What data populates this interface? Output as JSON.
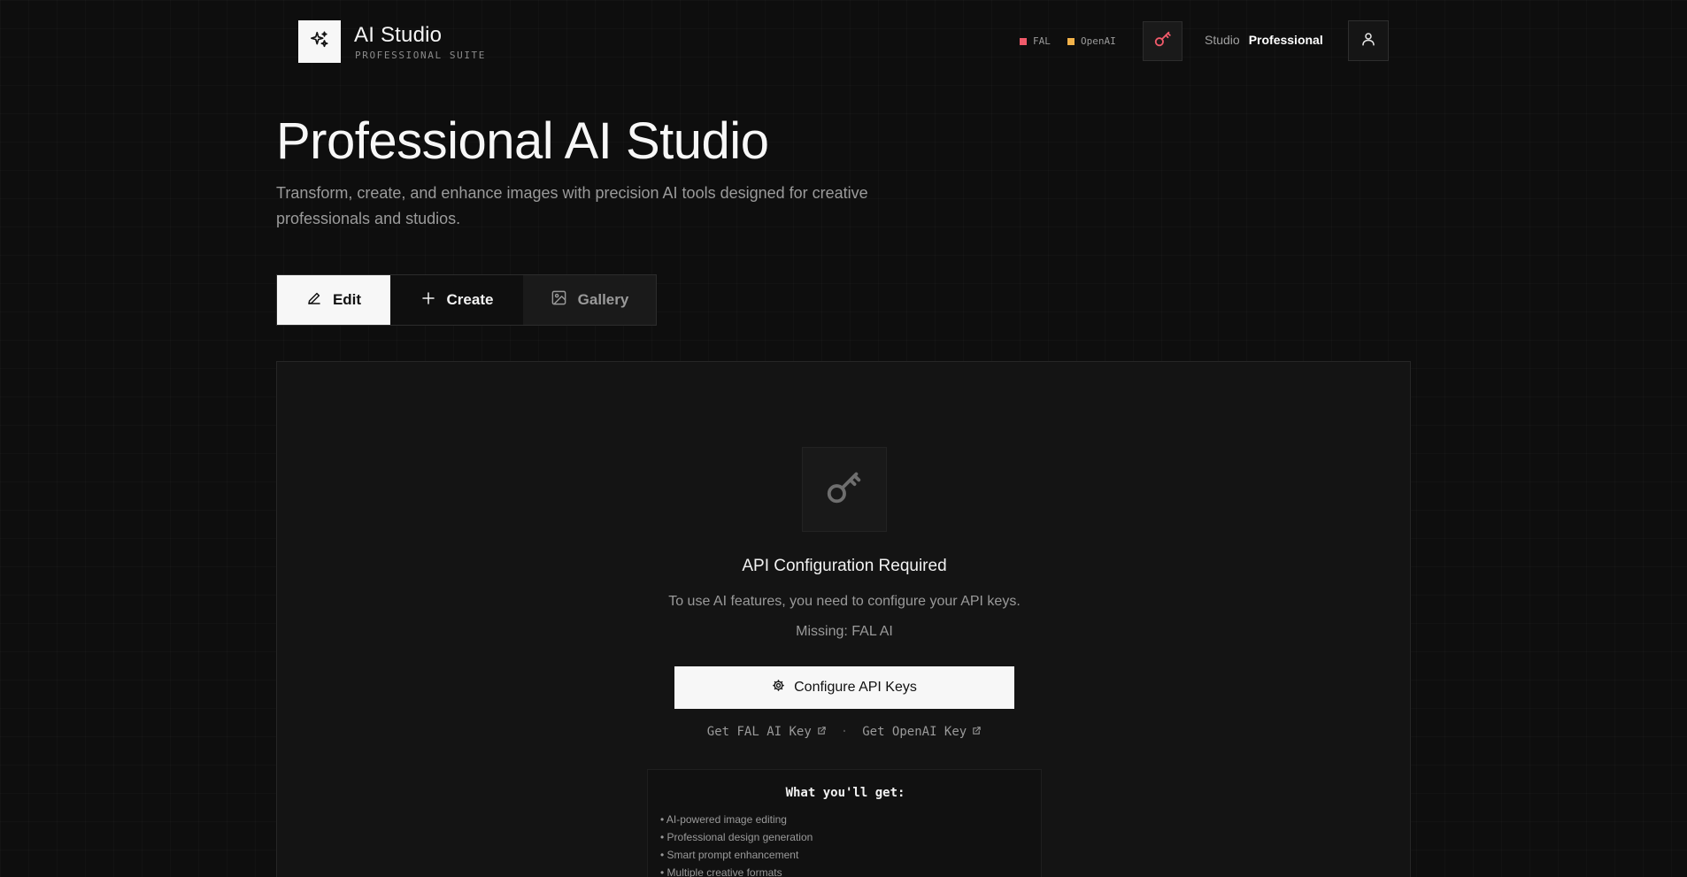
{
  "header": {
    "brand_title": "AI Studio",
    "brand_subtitle": "PROFESSIONAL SUITE",
    "logo_icon": "sparkles-icon",
    "providers": [
      {
        "label": "FAL",
        "color": "#f05a6a"
      },
      {
        "label": "OpenAI",
        "color": "#f2b24a"
      }
    ],
    "key_icon": "key-icon",
    "key_icon_color": "#f05a6a",
    "mode_label": "Studio",
    "mode_value": "Professional",
    "user_icon": "user-icon"
  },
  "hero": {
    "title": "Professional AI Studio",
    "description": "Transform, create, and enhance images with precision AI tools designed for creative professionals and studios."
  },
  "tabs": [
    {
      "label": "Edit",
      "icon": "pencil-icon",
      "active": true
    },
    {
      "label": "Create",
      "icon": "plus-icon",
      "active": false
    },
    {
      "label": "Gallery",
      "icon": "image-icon",
      "active": false
    }
  ],
  "config": {
    "icon": "key-icon",
    "title": "API Configuration Required",
    "description": "To use AI features, you need to configure your API keys.",
    "missing": "Missing: FAL AI",
    "button_label": "Configure API Keys",
    "button_icon": "gear-icon",
    "links": [
      {
        "label": "Get FAL AI Key",
        "icon": "external-link-icon"
      },
      {
        "label": "Get OpenAI Key",
        "icon": "external-link-icon"
      }
    ],
    "separator": "·"
  },
  "features": {
    "title": "What you'll get:",
    "items": [
      "• AI-powered image editing",
      "• Professional design generation",
      "• Smart prompt enhancement",
      "• Multiple creative formats"
    ]
  }
}
